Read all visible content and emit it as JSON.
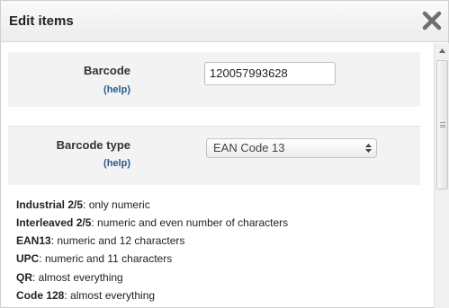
{
  "dialog": {
    "title": "Edit items",
    "close_icon": "close-x-icon"
  },
  "form": {
    "barcode": {
      "label": "Barcode",
      "help": "(help)",
      "value": "120057993628"
    },
    "barcode_type": {
      "label": "Barcode type",
      "help": "(help)",
      "selected": "EAN Code 13",
      "arrow_icon": "select-updown-icon"
    }
  },
  "info": [
    {
      "name": "Industrial 2/5",
      "desc": ": only numeric"
    },
    {
      "name": "Interleaved 2/5",
      "desc": ": numeric and even number of characters"
    },
    {
      "name": "EAN13",
      "desc": ": numeric and 12 characters"
    },
    {
      "name": "UPC",
      "desc": ": numeric and 11 characters"
    },
    {
      "name": "QR",
      "desc": ": almost everything"
    },
    {
      "name": "Code 128",
      "desc": ": almost everything"
    }
  ],
  "colors": {
    "help_link": "#2a5a8c",
    "row_background": "#f3f3f3"
  }
}
